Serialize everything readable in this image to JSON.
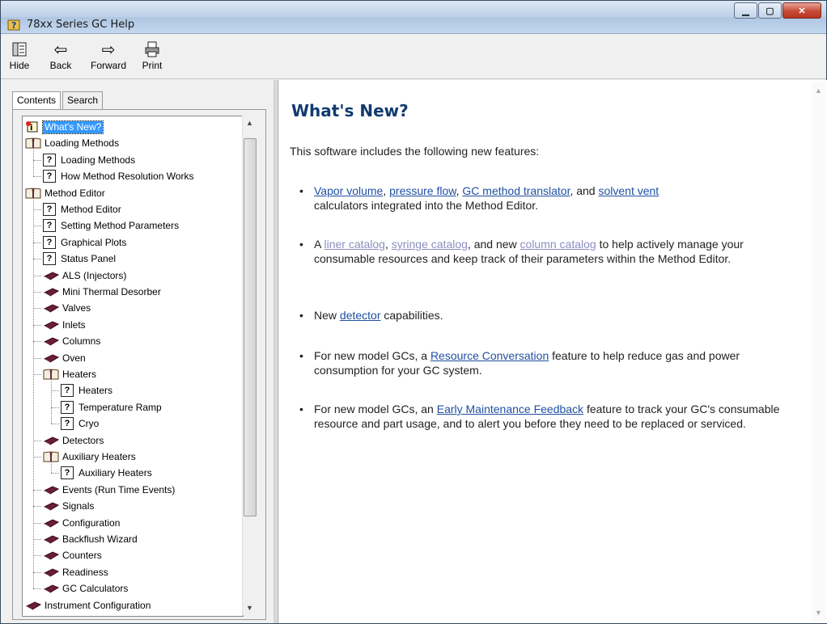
{
  "window": {
    "title": "78xx Series GC Help"
  },
  "toolbar": {
    "hide": "Hide",
    "back": "Back",
    "forward": "Forward",
    "print": "Print"
  },
  "tabs": {
    "contents": "Contents",
    "search": "Search"
  },
  "tree": [
    {
      "label": "What's New?",
      "icon": "new-topic",
      "indent": 0,
      "selected": true
    },
    {
      "label": "Loading Methods",
      "icon": "book-open",
      "indent": 0
    },
    {
      "label": "Loading Methods",
      "icon": "help-page",
      "indent": 1
    },
    {
      "label": "How Method Resolution Works",
      "icon": "help-page",
      "indent": 1
    },
    {
      "label": "Method Editor",
      "icon": "book-open",
      "indent": 0
    },
    {
      "label": "Method Editor",
      "icon": "help-page",
      "indent": 1
    },
    {
      "label": "Setting Method Parameters",
      "icon": "help-page",
      "indent": 1
    },
    {
      "label": "Graphical Plots",
      "icon": "help-page",
      "indent": 1
    },
    {
      "label": "Status Panel",
      "icon": "help-page",
      "indent": 1
    },
    {
      "label": "ALS (Injectors)",
      "icon": "book-closed",
      "indent": 1
    },
    {
      "label": "Mini Thermal Desorber",
      "icon": "book-closed",
      "indent": 1
    },
    {
      "label": "Valves",
      "icon": "book-closed",
      "indent": 1
    },
    {
      "label": "Inlets",
      "icon": "book-closed",
      "indent": 1
    },
    {
      "label": "Columns",
      "icon": "book-closed",
      "indent": 1
    },
    {
      "label": "Oven",
      "icon": "book-closed",
      "indent": 1
    },
    {
      "label": "Heaters",
      "icon": "book-open",
      "indent": 1
    },
    {
      "label": "Heaters",
      "icon": "help-page",
      "indent": 2
    },
    {
      "label": "Temperature Ramp",
      "icon": "help-page",
      "indent": 2
    },
    {
      "label": "Cryo",
      "icon": "help-page",
      "indent": 2
    },
    {
      "label": "Detectors",
      "icon": "book-closed",
      "indent": 1
    },
    {
      "label": "Auxiliary Heaters",
      "icon": "book-open",
      "indent": 1
    },
    {
      "label": "Auxiliary Heaters",
      "icon": "help-page",
      "indent": 2
    },
    {
      "label": "Events (Run Time Events)",
      "icon": "book-closed",
      "indent": 1
    },
    {
      "label": "Signals",
      "icon": "book-closed",
      "indent": 1
    },
    {
      "label": "Configuration",
      "icon": "book-closed",
      "indent": 1
    },
    {
      "label": "Backflush Wizard",
      "icon": "book-closed",
      "indent": 1
    },
    {
      "label": "Counters",
      "icon": "book-closed",
      "indent": 1
    },
    {
      "label": "Readiness",
      "icon": "book-closed",
      "indent": 1
    },
    {
      "label": "GC Calculators",
      "icon": "book-closed",
      "indent": 1
    },
    {
      "label": "Instrument Configuration",
      "icon": "book-closed",
      "indent": 0
    }
  ],
  "content": {
    "heading": "What's New?",
    "intro": "This software includes the following new features:",
    "b1": {
      "l1": "Vapor volume",
      "s1": ", ",
      "l2": "pressure flow",
      "s2": ", ",
      "l3": "GC method translator",
      "s3": ", and ",
      "l4": "solvent vent",
      "tail": "calculators integrated into the Method Editor."
    },
    "b2": {
      "pre": "A ",
      "l1": "liner catalog",
      "s1": ", ",
      "l2": "syringe catalog",
      "s2": ", and new ",
      "l3": "column catalog",
      "tail": " to help actively manage your consumable resources and keep track of their parameters within the Method Editor."
    },
    "b3": {
      "pre": "New ",
      "l1": "detector",
      "tail": " capabilities."
    },
    "b4": {
      "pre": "For new model GCs, a ",
      "l1": "Resource Conversation",
      "tail": " feature to help reduce gas and power consumption for your GC system."
    },
    "b5": {
      "pre": "For new model GCs, an ",
      "l1": "Early Maintenance Feedback",
      "tail": " feature to track your GC's consumable resource and part usage, and to alert you before they need to be replaced or serviced."
    }
  },
  "colors": {
    "link": "#1f4fa3",
    "visited": "#8b8fbf",
    "heading": "#123a70",
    "selection": "#3399ff"
  }
}
